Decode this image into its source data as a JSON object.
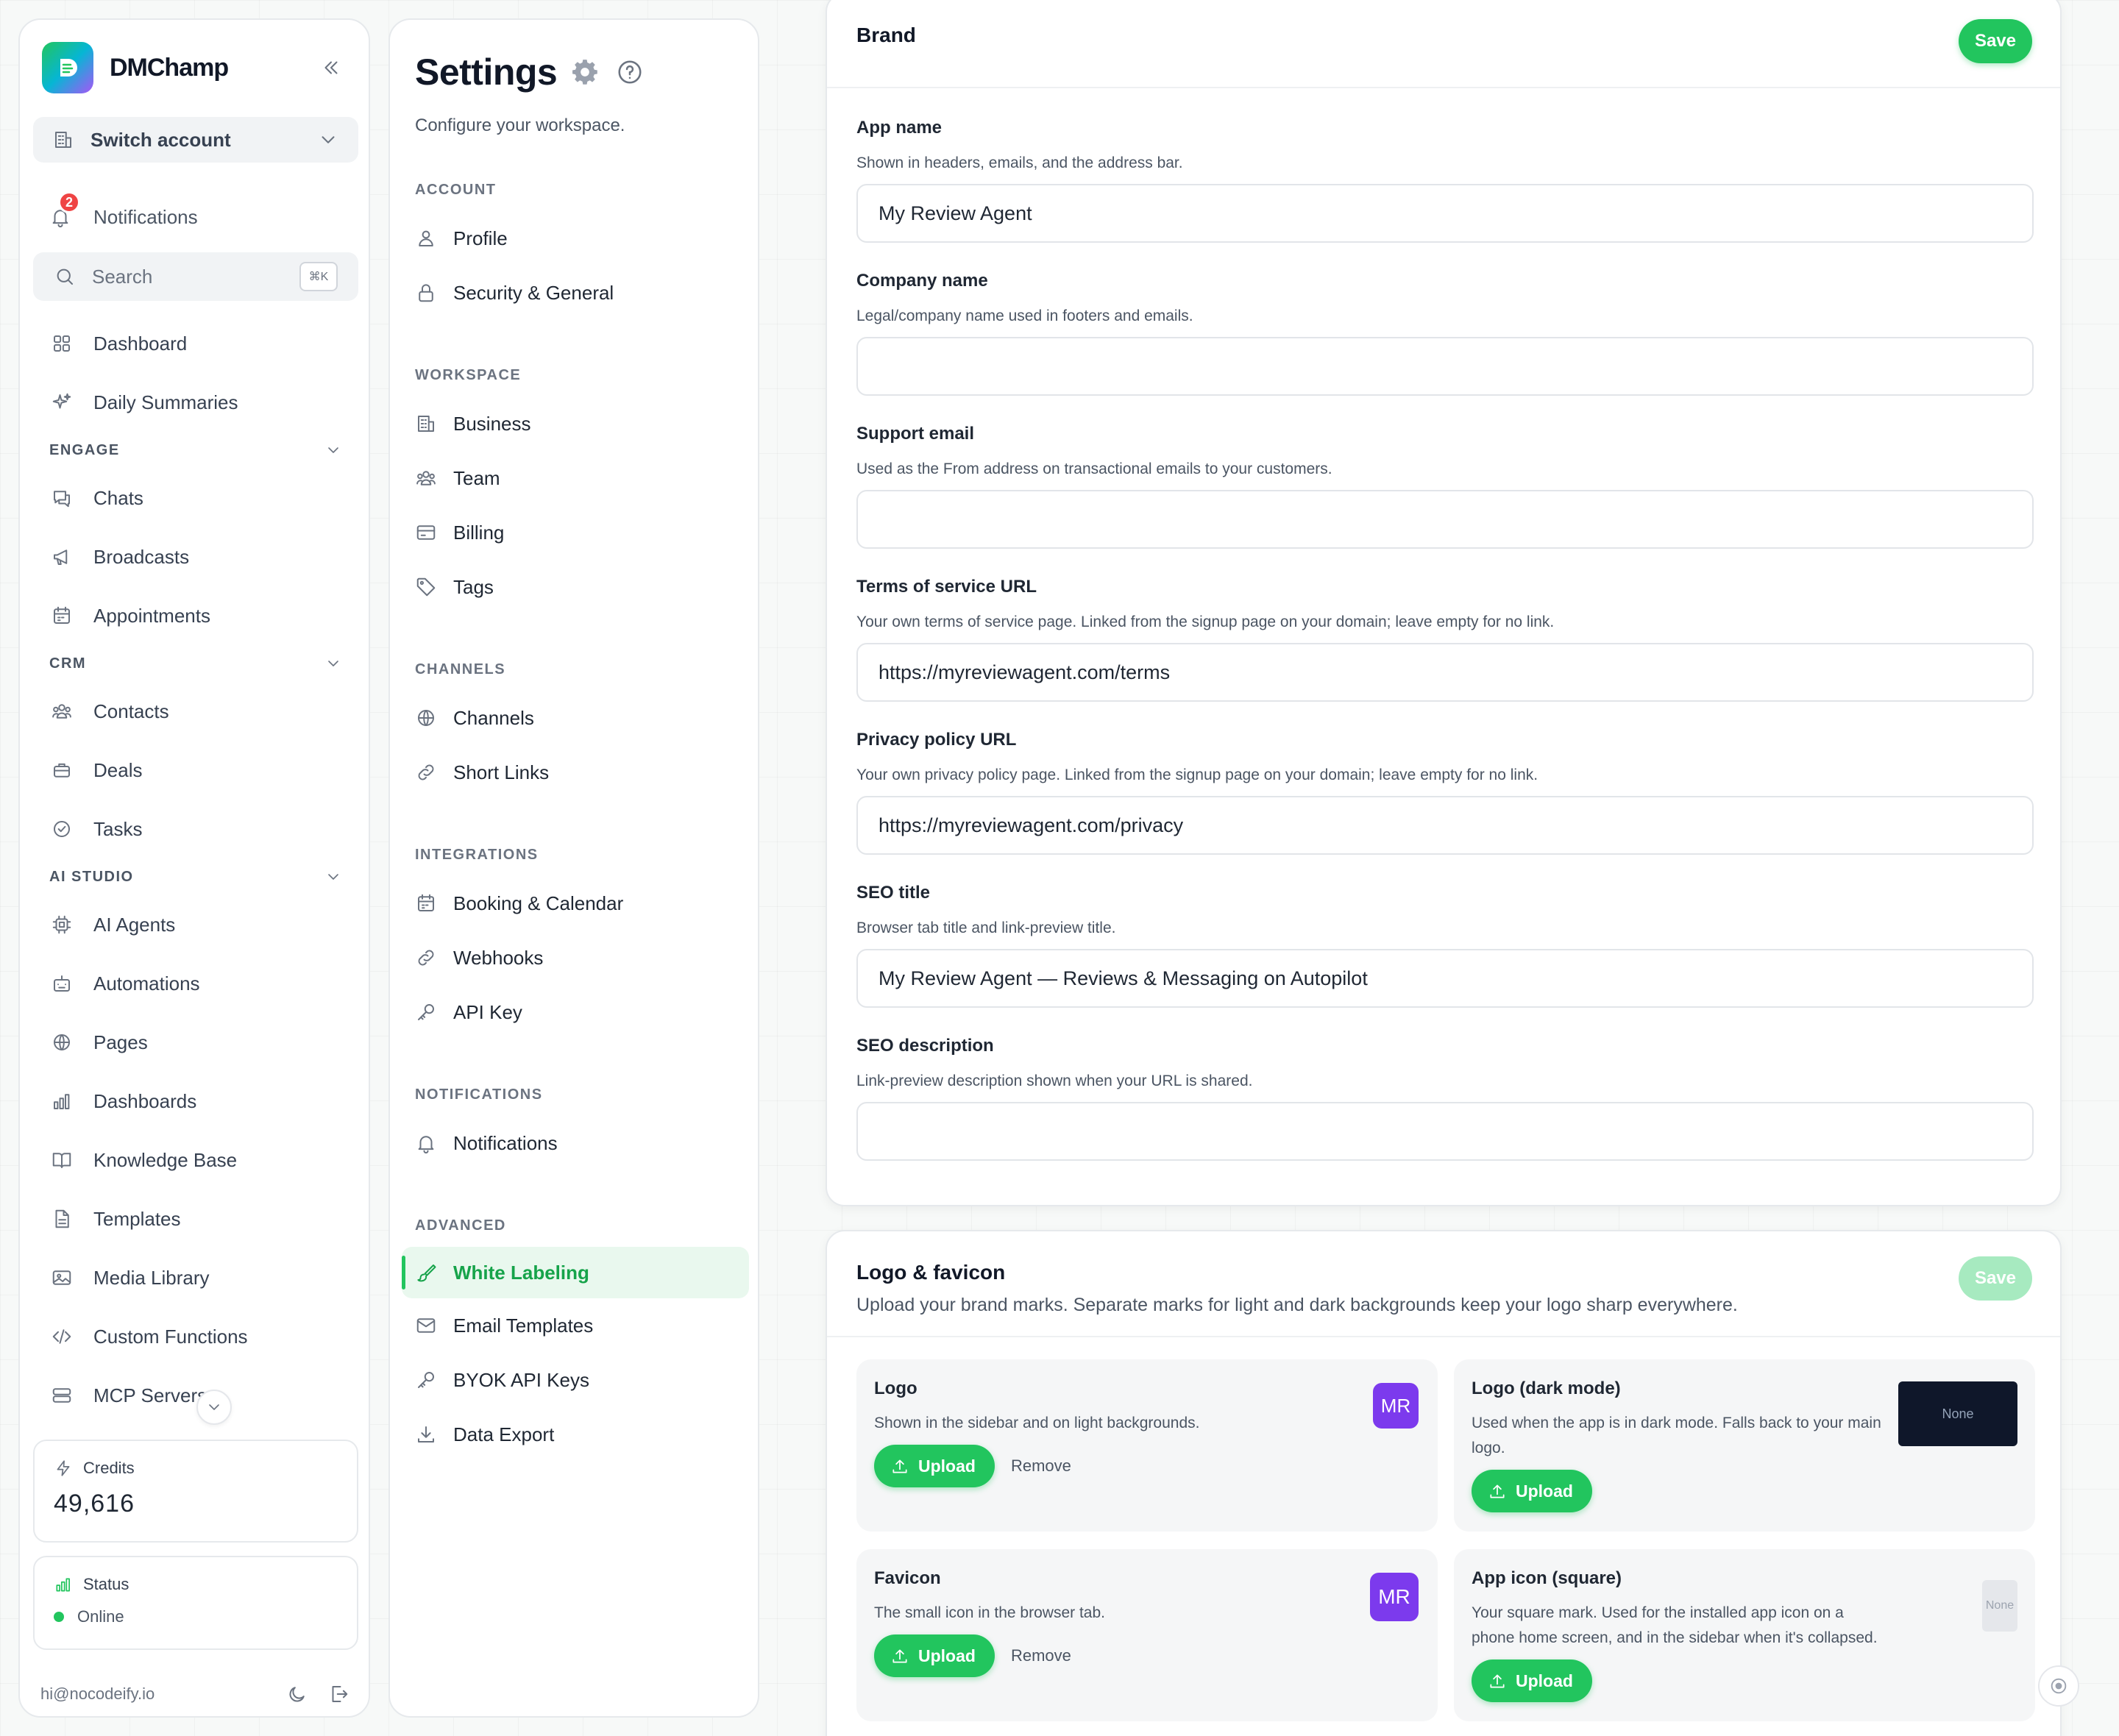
{
  "sidebar": {
    "brand": "DMChamp",
    "switch_account": "Switch account",
    "notifications": {
      "label": "Notifications",
      "count": "2"
    },
    "search": {
      "label": "Search",
      "shortcut": "⌘K"
    },
    "items_top": [
      {
        "label": "Dashboard",
        "icon": "grid-icon"
      },
      {
        "label": "Daily Summaries",
        "icon": "sparkle-icon"
      }
    ],
    "sections": [
      {
        "title": "ENGAGE",
        "items": [
          {
            "label": "Chats",
            "icon": "chat-icon"
          },
          {
            "label": "Broadcasts",
            "icon": "megaphone-icon"
          },
          {
            "label": "Appointments",
            "icon": "calendar-icon"
          }
        ]
      },
      {
        "title": "CRM",
        "items": [
          {
            "label": "Contacts",
            "icon": "users-icon"
          },
          {
            "label": "Deals",
            "icon": "briefcase-icon"
          },
          {
            "label": "Tasks",
            "icon": "check-circle-icon"
          }
        ]
      },
      {
        "title": "AI STUDIO",
        "items": [
          {
            "label": "AI Agents",
            "icon": "chip-icon"
          },
          {
            "label": "Automations",
            "icon": "robot-icon"
          },
          {
            "label": "Pages",
            "icon": "globe-icon"
          },
          {
            "label": "Dashboards",
            "icon": "bar-chart-icon"
          },
          {
            "label": "Knowledge Base",
            "icon": "book-icon"
          },
          {
            "label": "Templates",
            "icon": "document-icon"
          },
          {
            "label": "Media Library",
            "icon": "image-icon"
          },
          {
            "label": "Custom Functions",
            "icon": "code-icon"
          },
          {
            "label": "MCP Servers",
            "icon": "server-icon"
          }
        ]
      }
    ],
    "credits": {
      "label": "Credits",
      "value": "49,616"
    },
    "status": {
      "label": "Status",
      "value": "Online"
    },
    "email": "hi@nocodeify.io"
  },
  "settings_nav": {
    "title": "Settings",
    "subtitle": "Configure your workspace.",
    "sections": [
      {
        "title": "ACCOUNT",
        "items": [
          {
            "label": "Profile",
            "icon": "user-icon"
          },
          {
            "label": "Security & General",
            "icon": "lock-icon"
          }
        ]
      },
      {
        "title": "WORKSPACE",
        "items": [
          {
            "label": "Business",
            "icon": "building-icon"
          },
          {
            "label": "Team",
            "icon": "team-icon"
          },
          {
            "label": "Billing",
            "icon": "card-icon"
          },
          {
            "label": "Tags",
            "icon": "tag-icon"
          }
        ]
      },
      {
        "title": "CHANNELS",
        "items": [
          {
            "label": "Channels",
            "icon": "globe-icon"
          },
          {
            "label": "Short Links",
            "icon": "link-icon"
          }
        ]
      },
      {
        "title": "INTEGRATIONS",
        "items": [
          {
            "label": "Booking & Calendar",
            "icon": "calendar-icon"
          },
          {
            "label": "Webhooks",
            "icon": "link-icon"
          },
          {
            "label": "API Key",
            "icon": "key-icon"
          }
        ]
      },
      {
        "title": "NOTIFICATIONS",
        "items": [
          {
            "label": "Notifications",
            "icon": "bell-icon"
          }
        ]
      },
      {
        "title": "ADVANCED",
        "items": [
          {
            "label": "White Labeling",
            "icon": "brush-icon",
            "active": true
          },
          {
            "label": "Email Templates",
            "icon": "mail-icon"
          },
          {
            "label": "BYOK API Keys",
            "icon": "key-icon"
          },
          {
            "label": "Data Export",
            "icon": "download-icon"
          }
        ]
      }
    ]
  },
  "brand_card": {
    "title": "Brand",
    "save": "Save",
    "fields": [
      {
        "label": "App name",
        "help": "Shown in headers, emails, and the address bar.",
        "value": "My Review Agent"
      },
      {
        "label": "Company name",
        "help": "Legal/company name used in footers and emails.",
        "value": ""
      },
      {
        "label": "Support email",
        "help": "Used as the From address on transactional emails to your customers.",
        "value": ""
      },
      {
        "label": "Terms of service URL",
        "help": "Your own terms of service page. Linked from the signup page on your domain; leave empty for no link.",
        "value": "https://myreviewagent.com/terms"
      },
      {
        "label": "Privacy policy URL",
        "help": "Your own privacy policy page. Linked from the signup page on your domain; leave empty for no link.",
        "value": "https://myreviewagent.com/privacy"
      },
      {
        "label": "SEO title",
        "help": "Browser tab title and link-preview title.",
        "value": "My Review Agent — Reviews & Messaging on Autopilot"
      },
      {
        "label": "SEO description",
        "help": "Link-preview description shown when your URL is shared.",
        "value": ""
      }
    ]
  },
  "logo_card": {
    "title": "Logo & favicon",
    "subtitle": "Upload your brand marks. Separate marks for light and dark backgrounds keep your logo sharp everywhere.",
    "save": "Save",
    "assets": [
      {
        "name": "Logo",
        "desc": "Shown in the sidebar and on light backgrounds.",
        "upload": "Upload",
        "remove": "Remove",
        "preview": "MR"
      },
      {
        "name": "Logo (dark mode)",
        "desc": "Used when the app is in dark mode. Falls back to your main logo.",
        "upload": "Upload",
        "preview": "None"
      },
      {
        "name": "Favicon",
        "desc": "The small icon in the browser tab.",
        "upload": "Upload",
        "remove": "Remove",
        "preview": "MR"
      },
      {
        "name": "App icon (square)",
        "desc": "Your square mark. Used for the installed app icon on a phone home screen, and in the sidebar when it's collapsed.",
        "upload": "Upload",
        "preview": "None"
      }
    ]
  },
  "colors": {
    "accent": "#22c55e",
    "avatar": "#7c3aed",
    "badge": "#ef4444"
  }
}
